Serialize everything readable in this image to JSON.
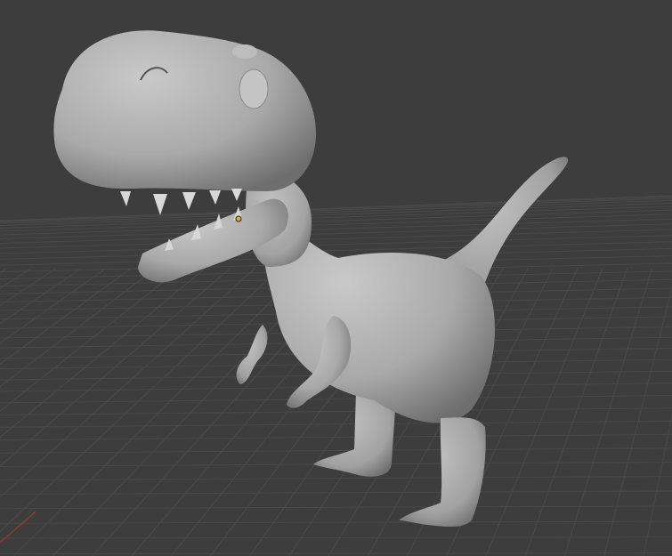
{
  "viewport": {
    "background": "#3d3d3d",
    "grid_color": "#4a4a4a",
    "x_axis_color": "#8a3a3a",
    "model_color": "#b4b4b4",
    "origin_color": "#f5a623"
  }
}
